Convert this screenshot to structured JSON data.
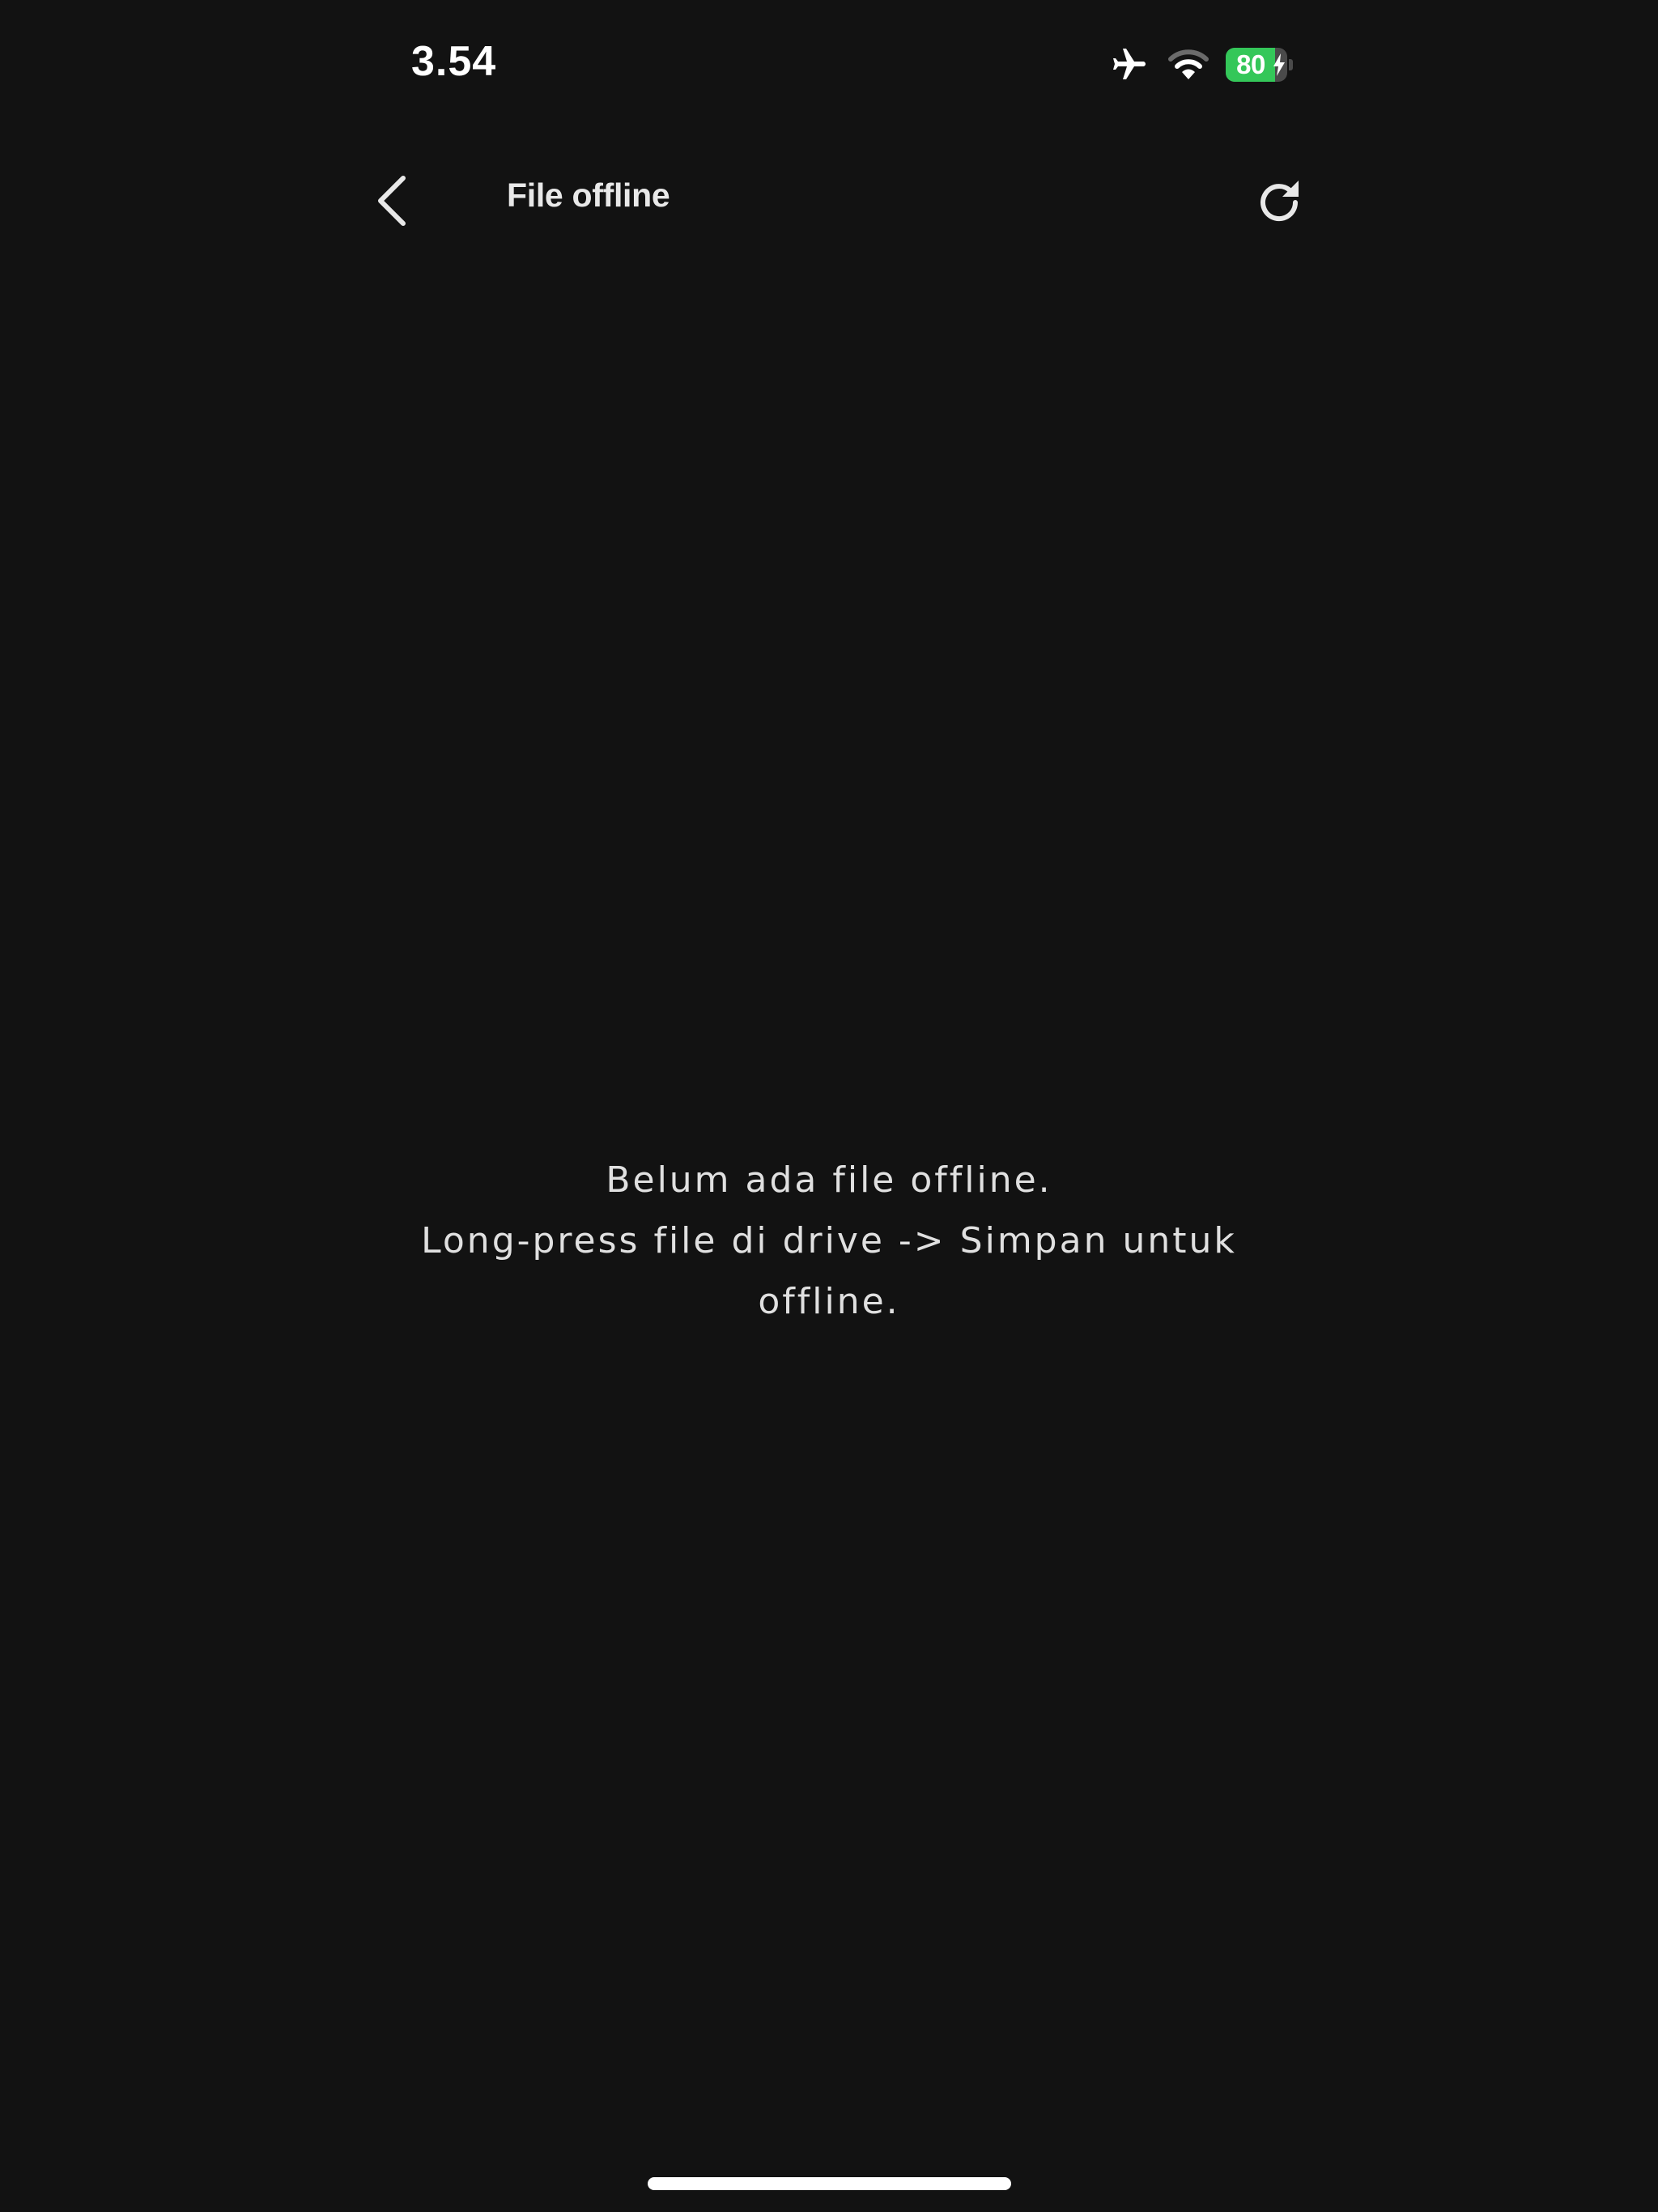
{
  "status_bar": {
    "time": "3.54",
    "battery_level": 80,
    "battery_label": "80",
    "airplane_mode": true,
    "wifi": true,
    "charging": true,
    "battery_color": "#34c759"
  },
  "nav": {
    "title": "File offline",
    "back_icon": "chevron-left-icon",
    "refresh_icon": "refresh-icon"
  },
  "empty_state": {
    "line1": "Belum ada file offline.",
    "line2": "Long-press file di drive -> Simpan untuk offline."
  },
  "theme": {
    "background": "#121212",
    "text": "#e0e0e0"
  }
}
